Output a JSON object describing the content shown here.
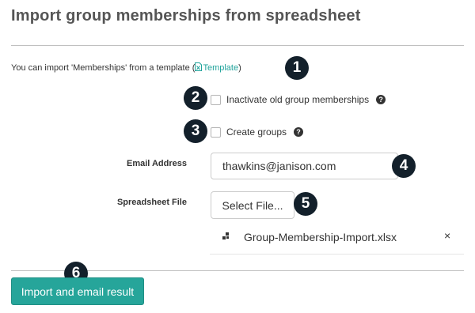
{
  "title": "Import group memberships from spreadsheet",
  "intro": {
    "prefix": "You can import 'Memberships' from a template (",
    "link_label": "Template",
    "suffix": ")"
  },
  "options": {
    "inactivate_label": "Inactivate old group memberships",
    "create_groups_label": "Create groups",
    "help_glyph": "?"
  },
  "email": {
    "label": "Email Address",
    "value": "thawkins@janison.com"
  },
  "spreadsheet": {
    "label": "Spreadsheet File",
    "select_button": "Select File...",
    "file_name": "Group-Membership-Import.xlsx",
    "remove_glyph": "×"
  },
  "submit_label": "Import and email result",
  "badges": [
    "1",
    "2",
    "3",
    "4",
    "5",
    "6"
  ],
  "colors": {
    "accent": "#26a59a",
    "link": "#1fa39b",
    "badge": "#13202b"
  }
}
